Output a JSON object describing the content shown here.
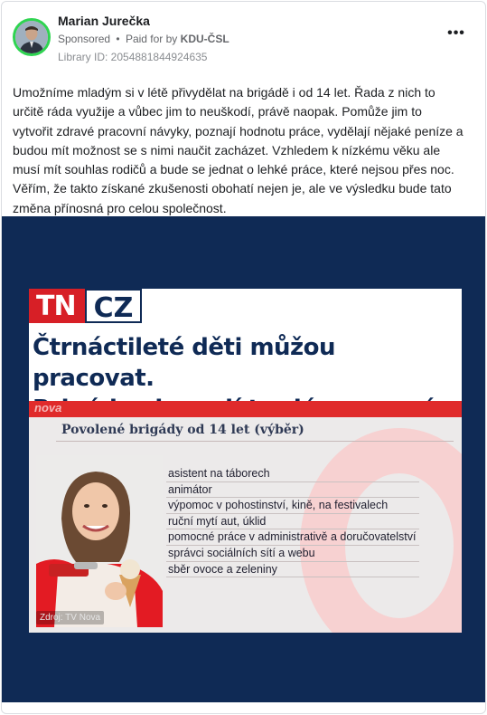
{
  "post": {
    "author": "Marian Jurečka",
    "sponsored": "Sponsored",
    "separator": "•",
    "paid_for_prefix": "Paid for by",
    "paid_for_by": "KDU-ČSL",
    "library_id": "Library ID: 2054881844924635",
    "more_options": "•••",
    "text": "Umožníme mladým si v létě přivydělat na brigádě i od 14 let. Řada z nich to určitě ráda využije a vůbec jim to neuškodí, právě naopak. Pomůže jim to vytvořit zdravé pracovní návyky, poznají hodnotu práce, vydělají nějaké peníze a budou mít možnost se s nimi naučit zacházet. Vzhledem k nízkému věku ale musí mít souhlas rodičů a bude se jednat o lehké práce, které nejsou přes noc. Věřím, že takto získané zkušenosti obohatí nejen je, ale ve výsledku bude tato změna přínosná pro celou společnost."
  },
  "media": {
    "logo_left": "TN",
    "logo_right": "CZ",
    "headline_line1": "Čtrnáctileté děti můžou pracovat.",
    "headline_line2": "Brigády ale mají tvrdá omezení",
    "nova_tag": "nova",
    "list_title": "Povolené brigády od 14 let (výběr)",
    "items": [
      "asistent na táborech",
      "animátor",
      "výpomoc v pohostinství, kině, na festivalech",
      "ruční mytí aut, úklid",
      "pomocné práce v administrativě a doručovatelství",
      "správci sociálních sítí a webu",
      "sběr ovoce a zeleniny"
    ],
    "source": "Zdroj: TV Nova"
  },
  "colors": {
    "media_bg": "#0f2a55",
    "tn_red": "#d71f26",
    "avatar_ring": "#2fd451"
  }
}
